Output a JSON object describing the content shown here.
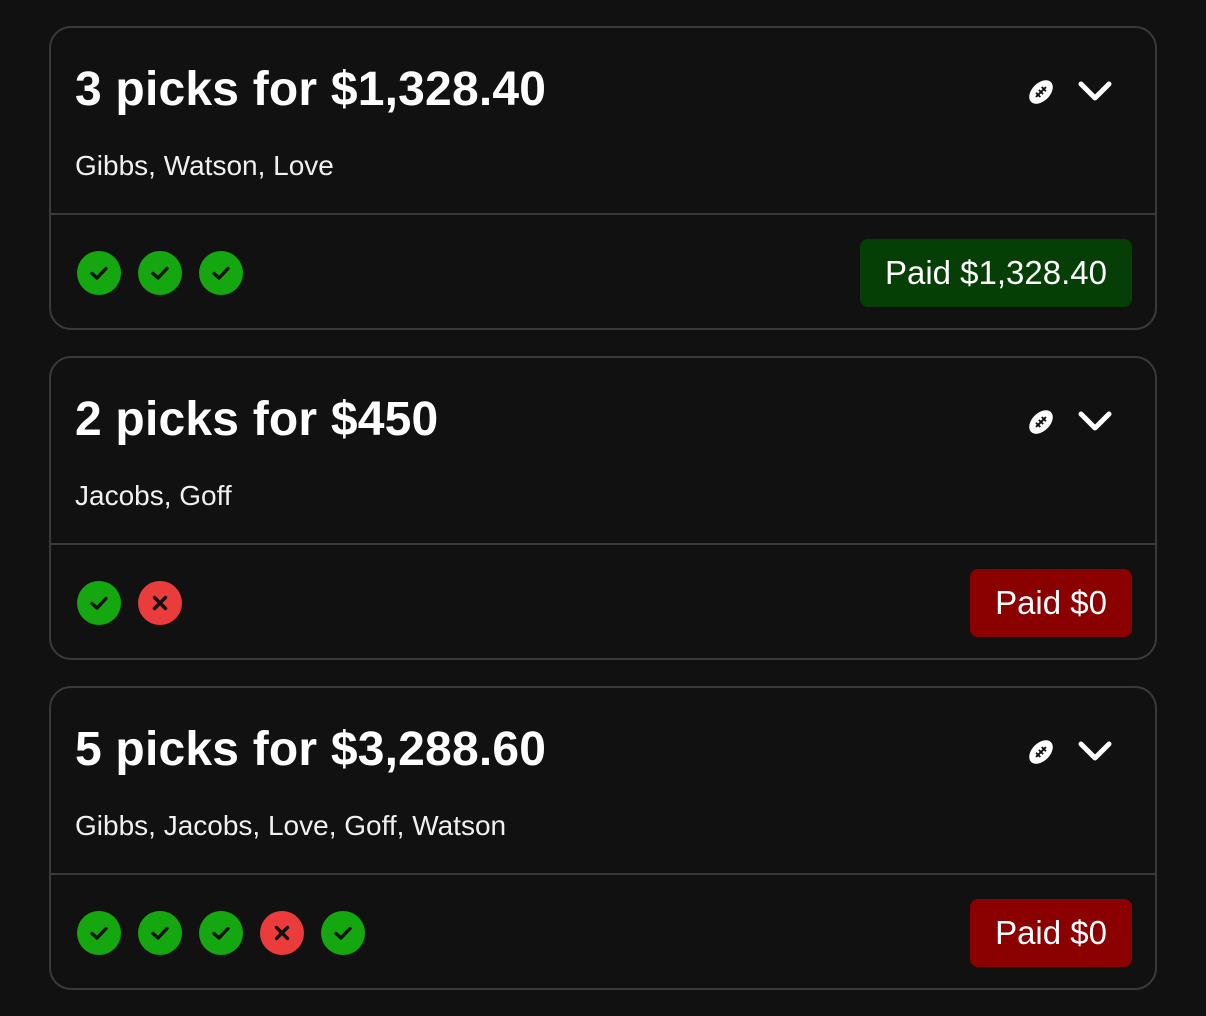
{
  "colors": {
    "background": "#111111",
    "card_border": "#3a3a3a",
    "win": "#14a70f",
    "loss": "#ea3c3a",
    "paid_won_bg": "#053f05",
    "paid_lost_bg": "#8b0000"
  },
  "icons": {
    "sport": "football-icon",
    "expand": "chevron-down-icon",
    "win": "check-icon",
    "loss": "x-icon"
  },
  "entries": [
    {
      "title": "3 picks for $1,328.40",
      "players": "Gibbs, Watson, Love",
      "results": [
        "win",
        "win",
        "win"
      ],
      "paid": "Paid $1,328.40",
      "status": "won"
    },
    {
      "title": "2 picks for $450",
      "players": "Jacobs, Goff",
      "results": [
        "win",
        "loss"
      ],
      "paid": "Paid $0",
      "status": "lost"
    },
    {
      "title": "5 picks for $3,288.60",
      "players": "Gibbs, Jacobs, Love, Goff, Watson",
      "results": [
        "win",
        "win",
        "win",
        "loss",
        "win"
      ],
      "paid": "Paid $0",
      "status": "lost"
    }
  ]
}
